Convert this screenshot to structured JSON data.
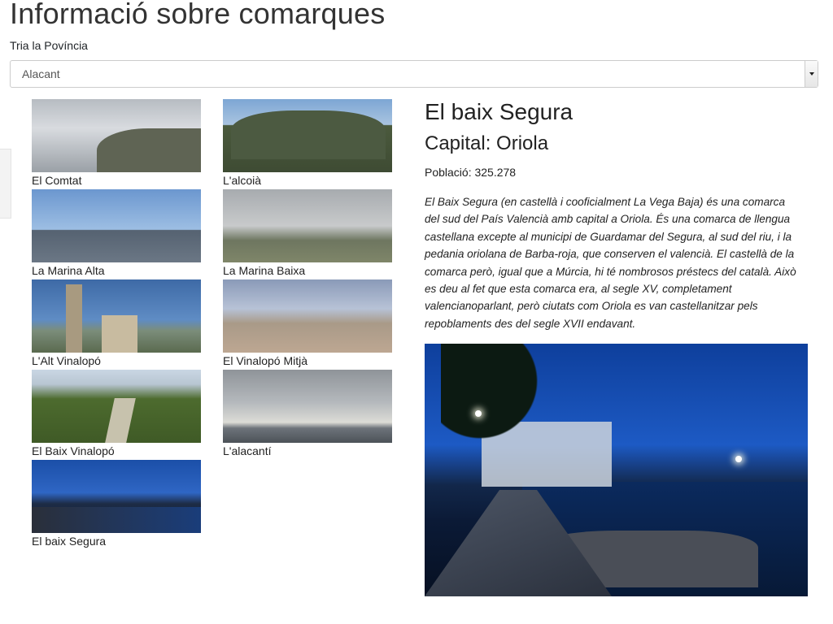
{
  "page": {
    "title": "Informació sobre comarques"
  },
  "province_select": {
    "label": "Tria la Povíncia",
    "selected": "Alacant"
  },
  "comarques": [
    {
      "name": "El Comtat",
      "image_icon": "mountain-photo-icon"
    },
    {
      "name": "L'alcoià",
      "image_icon": "mountain-photo-icon"
    },
    {
      "name": "La Marina Alta",
      "image_icon": "mountain-photo-icon"
    },
    {
      "name": "La Marina Baixa",
      "image_icon": "mountain-photo-icon"
    },
    {
      "name": "L'Alt Vinalopó",
      "image_icon": "castle-photo-icon"
    },
    {
      "name": "El Vinalopó Mitjà",
      "image_icon": "city-photo-icon"
    },
    {
      "name": "El Baix Vinalopó",
      "image_icon": "valley-photo-icon"
    },
    {
      "name": "L'alacantí",
      "image_icon": "sea-photo-icon"
    },
    {
      "name": "El baix Segura",
      "image_icon": "coast-photo-icon"
    }
  ],
  "detail": {
    "name": "El baix Segura",
    "capital": "Capital: Oriola",
    "population": "Població: 325.278",
    "description": "El Baix Segura (en castellà i cooficialment La Vega Baja) és una comarca del sud del País Valencià amb capital a Oriola. És una comarca de llengua castellana excepte al municipi de Guardamar del Segura, al sud del riu, i la pedania oriolana de Barba-roja, que conserven el valencià. El castellà de la comarca però, igual que a Múrcia, hi té nombrosos préstecs del català. Això es deu al fet que esta comarca era, al segle XV, completament valencianoparlant, però ciutats com Oriola es van castellanitzar pels repoblaments des del segle XVII endavant.",
    "photo_icon": "coast-night-photo-icon"
  }
}
